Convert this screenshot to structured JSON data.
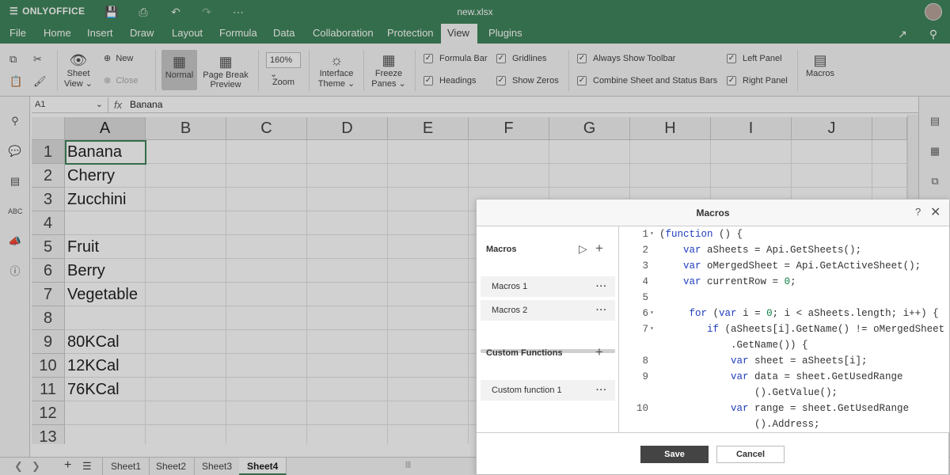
{
  "app": {
    "brand": "ONLYOFFICE",
    "title": "new.xlsx"
  },
  "menu": {
    "items": [
      "File",
      "Home",
      "Insert",
      "Draw",
      "Layout",
      "Formula",
      "Data",
      "Collaboration",
      "Protection",
      "View",
      "Plugins"
    ],
    "active": "View"
  },
  "toolbar": {
    "sheet_view": "Sheet View",
    "new": "New",
    "close": "Close",
    "normal": "Normal",
    "page_break": "Page Break Preview",
    "zoom_value": "160%",
    "zoom": "Zoom",
    "interface_theme": "Interface Theme",
    "freeze_panes": "Freeze Panes",
    "formula_bar": "Formula Bar",
    "headings": "Headings",
    "gridlines": "Gridlines",
    "show_zeros": "Show Zeros",
    "always_show_toolbar": "Always Show Toolbar",
    "combine_sheet": "Combine Sheet and Status Bars",
    "left_panel": "Left Panel",
    "right_panel": "Right Panel",
    "macros": "Macros"
  },
  "formula": {
    "cell": "A1",
    "fx": "fx",
    "value": "Banana"
  },
  "columns": [
    "A",
    "B",
    "C",
    "D",
    "E",
    "F",
    "G",
    "H",
    "I",
    "J"
  ],
  "rows": [
    "1",
    "2",
    "3",
    "4",
    "5",
    "6",
    "7",
    "8",
    "9",
    "10",
    "11",
    "12",
    "13"
  ],
  "cells_a": [
    "Banana",
    "Cherry",
    "Zucchini",
    "",
    "Fruit",
    "Berry",
    "Vegetable",
    "",
    "80KCal",
    "12KCal",
    "76KCal",
    "",
    ""
  ],
  "sheets": [
    "Sheet1",
    "Sheet2",
    "Sheet3",
    "Sheet4"
  ],
  "active_sheet": "Sheet4",
  "dialog": {
    "title": "Macros",
    "help": "?",
    "macros_label": "Macros",
    "macros": [
      "Macros 1",
      "Macros 2"
    ],
    "custom_label": "Custom Functions",
    "custom": [
      "Custom function 1"
    ],
    "dots": "···",
    "save": "Save",
    "cancel": "Cancel"
  },
  "code": {
    "line_numbers": [
      "1",
      "2",
      "3",
      "4",
      "5",
      "6",
      "7",
      "",
      "8",
      "9",
      "",
      "10",
      ""
    ],
    "lines": [
      "(function () {",
      "    var aSheets = Api.GetSheets();",
      "    var oMergedSheet = Api.GetActiveSheet();",
      "    var currentRow = 0;",
      "",
      "     for (var i = 0; i < aSheets.length; i++) {",
      "        if (aSheets[i].GetName() != oMergedSheet",
      "            .GetName()) {",
      "            var sheet = aSheets[i];",
      "            var data = sheet.GetUsedRange",
      "                ().GetValue();",
      "            var range = sheet.GetUsedRange",
      "                ().Address;"
    ]
  },
  "icons": {
    "brand": "layers-icon",
    "save": "floppy-icon",
    "print": "printer-icon",
    "undo": "undo-icon",
    "redo": "redo-icon",
    "more": "ellipsis-icon"
  }
}
